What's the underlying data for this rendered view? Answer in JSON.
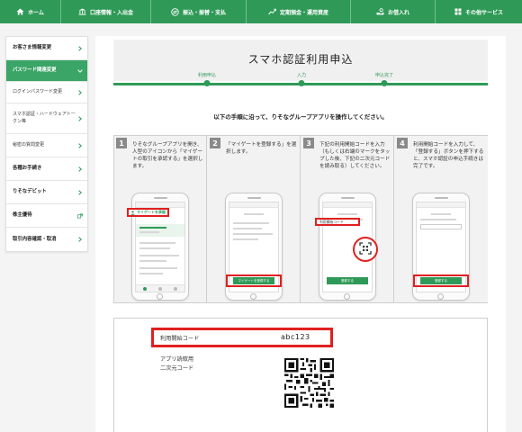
{
  "nav": {
    "items": [
      {
        "label": "ホーム",
        "icon": "home-icon"
      },
      {
        "label": "口座情報・入出金",
        "icon": "bank-icon"
      },
      {
        "label": "振込・振替・支払",
        "icon": "transfer-icon"
      },
      {
        "label": "定期預金・運用資産",
        "icon": "chart-icon"
      },
      {
        "label": "お借入れ",
        "icon": "loan-icon"
      },
      {
        "label": "その他サービス",
        "icon": "menu-grid-icon"
      }
    ]
  },
  "sidebar": {
    "items": [
      {
        "label": "お客さま情報変更",
        "type": "section",
        "chevron": "right"
      },
      {
        "label": "パスワード関連変更",
        "type": "section",
        "chevron": "down",
        "active": true
      },
      {
        "label": "ログインパスワード変更",
        "type": "sub",
        "chevron": "right"
      },
      {
        "label": "スマホ認証・ハードウェアトークン等",
        "type": "sub",
        "chevron": "right"
      },
      {
        "label": "秘密の質問変更",
        "type": "sub",
        "chevron": "right"
      },
      {
        "label": "各種お手続き",
        "type": "section",
        "chevron": "right"
      },
      {
        "label": "りそなデビット",
        "type": "section",
        "chevron": "right"
      },
      {
        "label": "株主優待",
        "type": "section",
        "chevron": "external"
      },
      {
        "label": "取引内容確認・取消",
        "type": "section",
        "chevron": "right"
      }
    ]
  },
  "page": {
    "title": "スマホ認証利用申込",
    "progress_steps": [
      "利用申込",
      "入力",
      "申込完了"
    ],
    "instruction": "以下の手順に沿って、りそなグループアプリを操作してください。"
  },
  "steps": [
    {
      "num": "1",
      "text": "りそなグループアプリを開き、人型のアイコンから「マイゲートの取引を承認する」を選択します。"
    },
    {
      "num": "2",
      "text": "「マイゲートを登録する」を選択します。"
    },
    {
      "num": "3",
      "text": "下記の利用開始コードを入力（もしくは右端のマークをタップした後、下記の二次元コードを読み取る）してください。"
    },
    {
      "num": "4",
      "text": "利用開始コードを入力して、「登録する」ボタンを押下すると、スマホ認証の申込手続きは完了です。"
    }
  ],
  "phones": {
    "app_label": "マイゲートを承認",
    "register_button": "マイゲートを登録する",
    "code_field_label": "利用開始コード",
    "register_button_short": "登録する"
  },
  "code_box": {
    "code_label": "利用開始コード",
    "code_value": "abc123",
    "qr_label_line1": "アプリ読取用",
    "qr_label_line2": "二次元コード"
  },
  "colors": {
    "brand_green": "#2f9a57",
    "highlight_red": "#e02020"
  }
}
